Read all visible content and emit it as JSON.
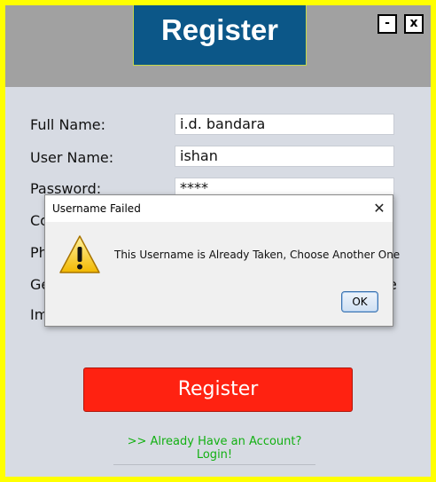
{
  "window": {
    "title": "Register",
    "minimize_label": "-",
    "close_label": "x"
  },
  "form": {
    "fields": [
      {
        "label": "Full Name:",
        "value": "i.d. bandara"
      },
      {
        "label": "User Name:",
        "value": "ishan"
      },
      {
        "label": "Password:",
        "value": "****"
      },
      {
        "label": "Co",
        "value": ""
      },
      {
        "label": "Ph",
        "value": ""
      },
      {
        "label": "Ge",
        "value": ""
      },
      {
        "label": "Im",
        "value": ""
      }
    ],
    "hidden_right_fragment": "e",
    "register_button": "Register",
    "login_link": ">> Already Have an Account? Login!"
  },
  "dialog": {
    "title": "Username Failed",
    "message": "This Username is Already Taken, Choose Another One",
    "ok_label": "OK",
    "close_label": "✕",
    "icon": "warning-icon"
  },
  "colors": {
    "outer_border": "#ffff00",
    "header_bg": "#a1a1a1",
    "title_bg": "#0c5788",
    "register_button": "#ff2211",
    "link": "#12b012"
  }
}
